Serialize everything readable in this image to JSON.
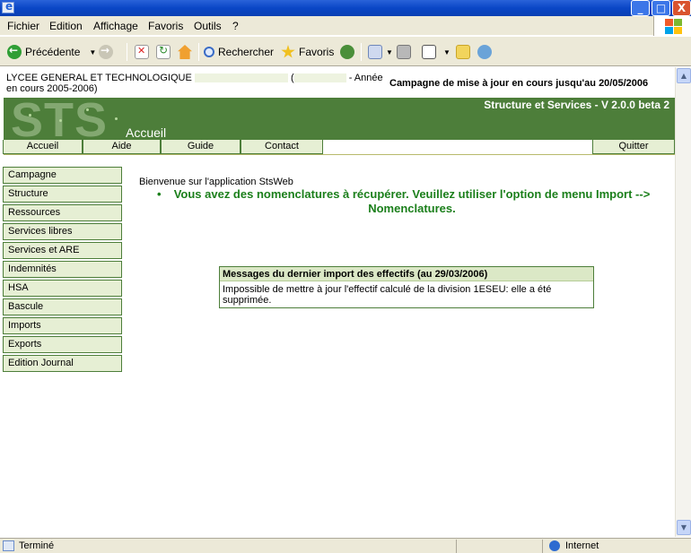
{
  "window": {
    "min": "_",
    "max": "□",
    "close": "X"
  },
  "menu": [
    "Fichier",
    "Edition",
    "Affichage",
    "Favoris",
    "Outils",
    "?"
  ],
  "toolbar": {
    "back": "Précédente",
    "search": "Rechercher",
    "favorites": "Favoris"
  },
  "header": {
    "school": "LYCEE GENERAL ET TECHNOLOGIQUE",
    "year_open": "(",
    "year_label": "- Année",
    "year_cont": "en cours 2005-2006)",
    "campaign": "Campagne de mise à jour en cours jusqu'au 20/05/2006",
    "logo": "STS",
    "version": "Structure et Services - V 2.0.0 beta 2",
    "page_title": "Accueil"
  },
  "topnav": {
    "home": "Accueil",
    "help": "Aide",
    "guide": "Guide",
    "contact": "Contact",
    "quit": "Quitter"
  },
  "sidemenu": [
    "Campagne",
    "Structure",
    "Ressources",
    "Services libres",
    "Services et ARE",
    "Indemnités",
    "HSA",
    "Bascule",
    "Imports",
    "Exports",
    "Edition Journal"
  ],
  "main": {
    "welcome": "Bienvenue sur l'application StsWeb",
    "bullet": "•",
    "notice": "Vous avez des nomenclatures à récupérer. Veuillez utiliser l'option de menu Import --> Nomenclatures.",
    "msg_title": "Messages du dernier import des effectifs (au 29/03/2006)",
    "msg_body": "Impossible de mettre à jour l'effectif calculé de la division 1ESEU: elle a été supprimée."
  },
  "status": {
    "left": "Terminé",
    "zone": "Internet"
  },
  "colors": {
    "green_dark": "#4d7e3a",
    "green_light": "#e6efd4",
    "notice_green": "#1b7f1b"
  }
}
